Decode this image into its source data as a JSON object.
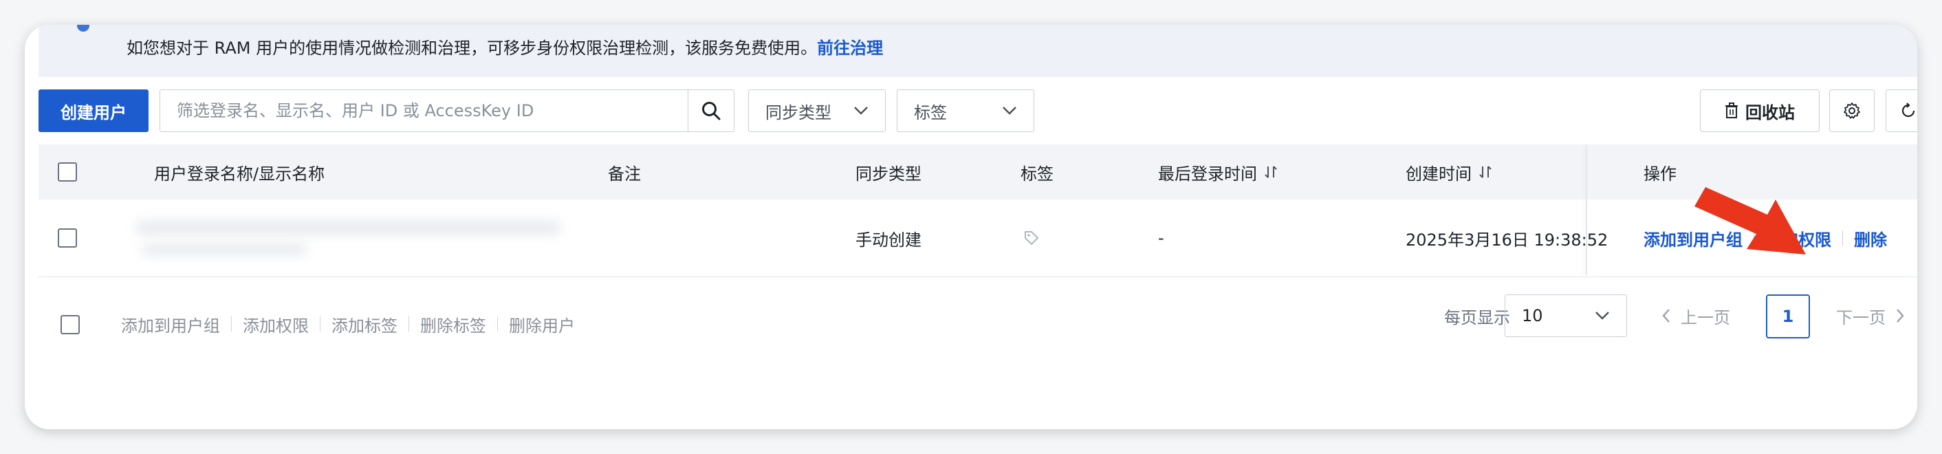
{
  "notice": {
    "text": "如您想对于 RAM 用户的使用情况做检测和治理，可移步身份权限治理检测，该服务免费使用。",
    "link": "前往治理"
  },
  "toolbar": {
    "create_user": "创建用户",
    "search_placeholder": "筛选登录名、显示名、用户 ID 或 AccessKey ID",
    "sync_type_select": "同步类型",
    "tag_select": "标签",
    "recycle_bin": "回收站"
  },
  "table": {
    "columns": {
      "user_name": "用户登录名称/显示名称",
      "remark": "备注",
      "sync_type": "同步类型",
      "tag": "标签",
      "last_login": "最后登录时间",
      "created_time": "创建时间",
      "actions": "操作"
    },
    "rows": [
      {
        "sync_type": "手动创建",
        "last_login": "-",
        "created_time": "2025年3月16日 19:38:52",
        "actions": {
          "add_to_group": "添加到用户组",
          "add_permission": "添加权限",
          "delete": "删除"
        }
      }
    ]
  },
  "batch_actions": {
    "add_to_group": "添加到用户组",
    "add_permission": "添加权限",
    "add_tag": "添加标签",
    "delete_tag": "删除标签",
    "delete_user": "删除用户"
  },
  "pagination": {
    "page_size_label": "每页显示",
    "page_size": "10",
    "prev": "上一页",
    "current_page": "1",
    "next": "下一页"
  },
  "colors": {
    "primary": "#1d5ccf",
    "link": "#1859d1",
    "annotation_arrow": "#e8351c"
  }
}
